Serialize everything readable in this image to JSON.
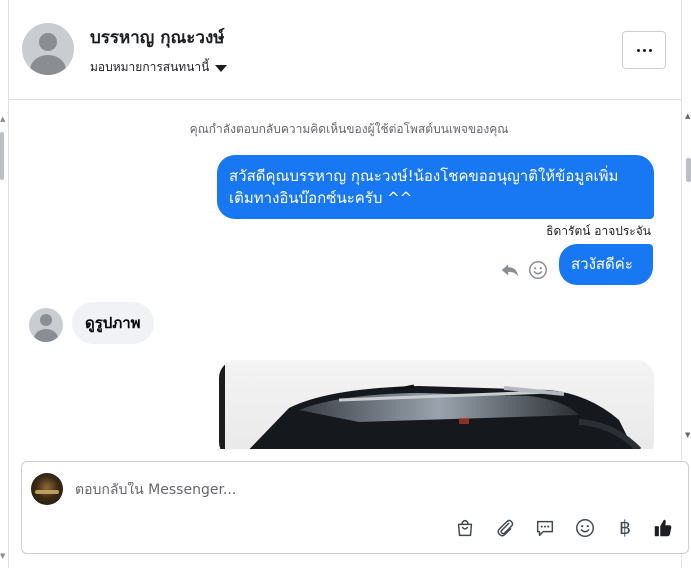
{
  "header": {
    "contact_name": "บรรหาญ กุณะวงษ์",
    "assign_label": "มอบหมายการสนทนานี้",
    "more_icon": "more-horizontal-icon"
  },
  "thread": {
    "context_note": "คุณกำลังตอบกลับความคิดเห็นของผู้ใช้ต่อโพสต์บนเพจของคุณ",
    "messages": [
      {
        "direction": "outgoing",
        "text": "สวัสดีคุณบรรหาญ กุณะวงษ์!น้องโชคขออนุญาติให้ข้อมูลเพิ่มเติมทางอินบ๊อกซ์นะครับ ^^"
      },
      {
        "direction": "outgoing",
        "sender": "ธิดารัตน์ อาจประจัน",
        "text": "สวงัสดีค่ะ"
      },
      {
        "direction": "incoming",
        "text": "ดูรูปภาพ"
      },
      {
        "direction": "incoming",
        "type": "photo",
        "description_icon": "car-photo"
      }
    ],
    "message_actions": {
      "reply_icon": "reply-icon",
      "react_icon": "smile-icon"
    }
  },
  "composer": {
    "placeholder": "ตอบกลับใน Messenger...",
    "tools": [
      "shopping-bag-icon",
      "paperclip-icon",
      "chat-bubble-icon",
      "emoji-icon",
      "baht-icon",
      "thumbs-up-icon"
    ],
    "baht_symbol": "฿"
  },
  "colors": {
    "accent": "#1877f2",
    "incoming_bubble": "#f0f2f5",
    "muted_text": "#65676b"
  }
}
